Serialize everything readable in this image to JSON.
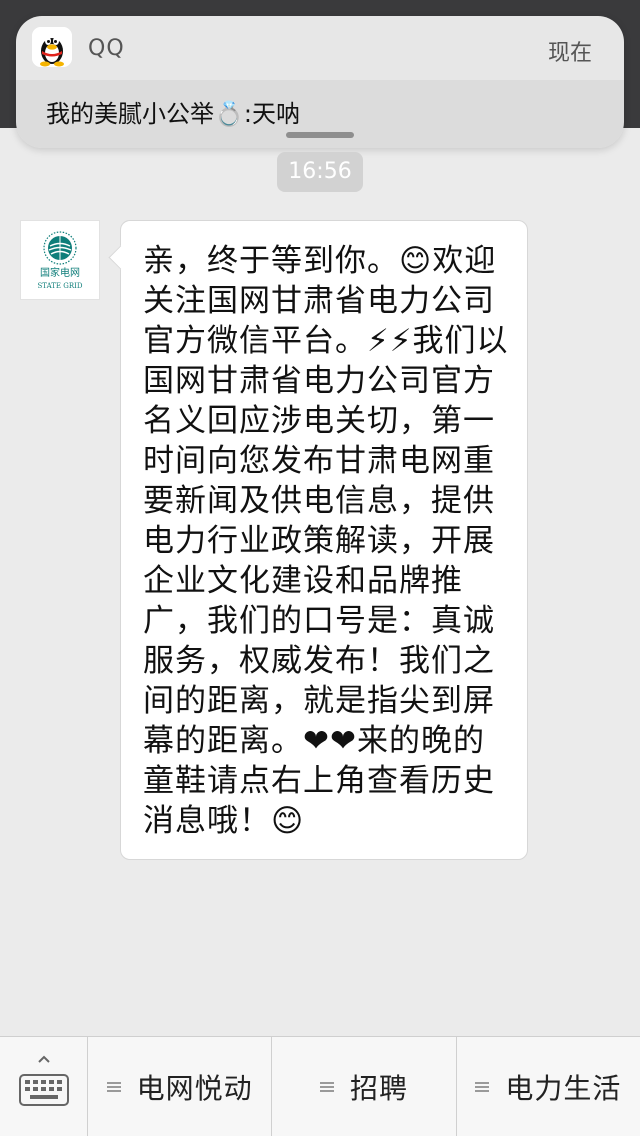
{
  "notification": {
    "app_name": "QQ",
    "time": "现在",
    "message": "我的美腻小公举💍:天呐",
    "app_icon": "qq-penguin-icon"
  },
  "chat": {
    "timestamp": "16:56",
    "avatar": {
      "name_cn": "国家电网",
      "name_en": "STATE GRID",
      "icon": "state-grid-logo-icon"
    },
    "message_text": "亲，终于等到你。😊欢迎关注国网甘肃省电力公司官方微信平台。⚡⚡我们以国网甘肃省电力公司官方名义回应涉电关切，第一时间向您发布甘肃电网重要新闻及供电信息，提供电力行业政策解读，开展企业文化建设和品牌推广，我们的口号是：真诚服务，权威发布！我们之间的距离，就是指尖到屏幕的距离。❤❤来的晚的童鞋请点右上角查看历史消息哦！😊"
  },
  "menu_bar": {
    "keyboard_icon": "keyboard-icon",
    "items": [
      {
        "label": "电网悦动",
        "icon": "menu-list-icon"
      },
      {
        "label": "招聘",
        "icon": "menu-list-icon"
      },
      {
        "label": "电力生活",
        "icon": "menu-list-icon"
      }
    ]
  },
  "colors": {
    "background": "#ebebeb",
    "bubble": "#ffffff",
    "logo_teal": "#0f7e7a"
  }
}
